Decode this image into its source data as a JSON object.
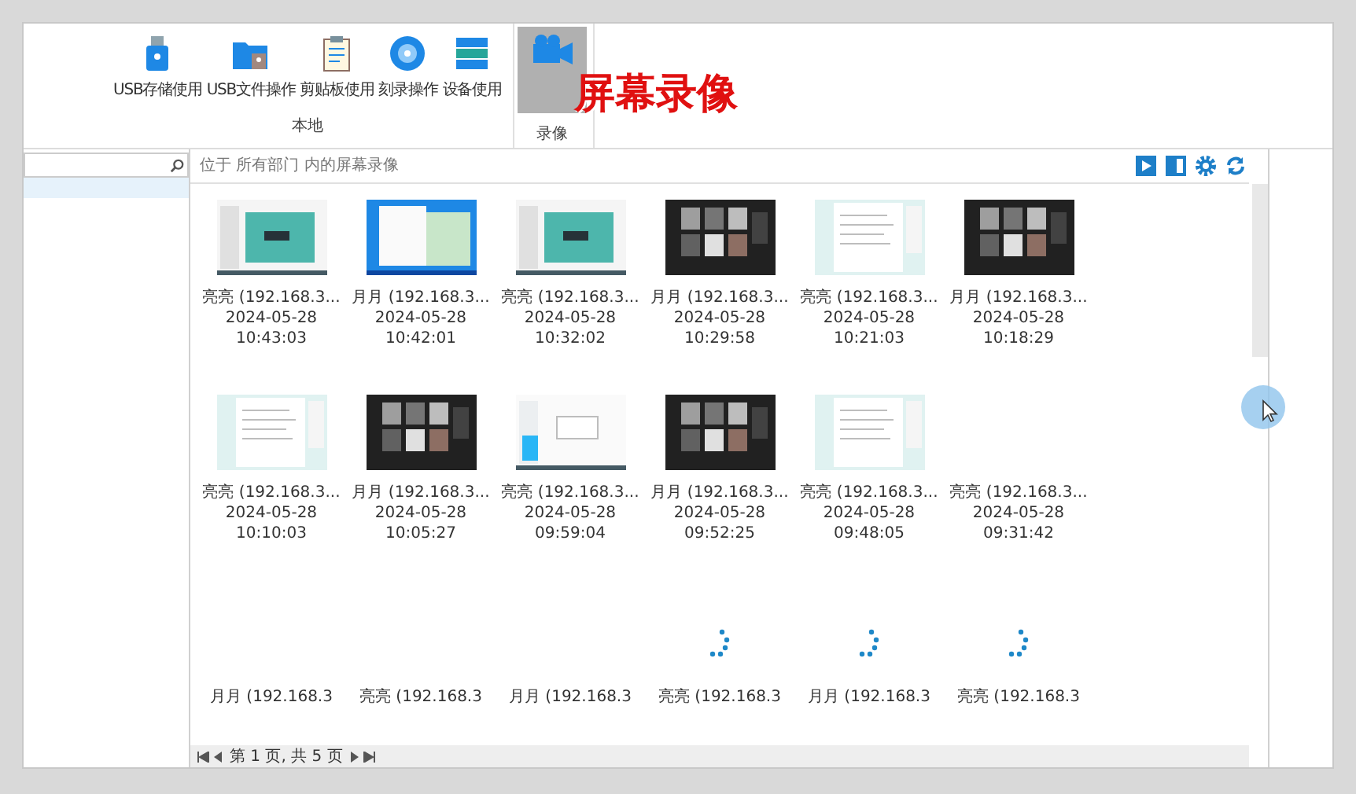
{
  "ribbon": {
    "items": [
      {
        "label": "USB存储使用"
      },
      {
        "label": "USB文件操作"
      },
      {
        "label": "剪贴板使用"
      },
      {
        "label": "刻录操作"
      },
      {
        "label": "设备使用"
      }
    ],
    "group_label": "本地",
    "selected_group": {
      "label": "录像",
      "selected": true
    }
  },
  "caption": "屏幕录像",
  "content": {
    "breadcrumb": "位于 所有部门 内的屏幕录像",
    "recordings": [
      {
        "name": "亮亮 (192.168.3...",
        "date": "2024-05-28",
        "time": "10:43:03"
      },
      {
        "name": "月月 (192.168.3...",
        "date": "2024-05-28",
        "time": "10:42:01"
      },
      {
        "name": "亮亮 (192.168.3...",
        "date": "2024-05-28",
        "time": "10:32:02"
      },
      {
        "name": "月月 (192.168.3...",
        "date": "2024-05-28",
        "time": "10:29:58"
      },
      {
        "name": "亮亮 (192.168.3...",
        "date": "2024-05-28",
        "time": "10:21:03"
      },
      {
        "name": "月月 (192.168.3...",
        "date": "2024-05-28",
        "time": "10:18:29"
      },
      {
        "name": "亮亮 (192.168.3...",
        "date": "2024-05-28",
        "time": "10:10:03"
      },
      {
        "name": "月月 (192.168.3...",
        "date": "2024-05-28",
        "time": "10:05:27"
      },
      {
        "name": "亮亮 (192.168.3...",
        "date": "2024-05-28",
        "time": "09:59:04"
      },
      {
        "name": "月月 (192.168.3...",
        "date": "2024-05-28",
        "time": "09:52:25"
      },
      {
        "name": "亮亮 (192.168.3...",
        "date": "2024-05-28",
        "time": "09:48:05"
      },
      {
        "name": "亮亮 (192.168.3...",
        "date": "2024-05-28",
        "time": "09:31:42"
      },
      {
        "name": "月月 (192.168.3"
      },
      {
        "name": "亮亮 (192.168.3"
      },
      {
        "name": "月月 (192.168.3"
      },
      {
        "name": "亮亮 (192.168.3",
        "loading": true
      },
      {
        "name": "月月 (192.168.3",
        "loading": true
      },
      {
        "name": "亮亮 (192.168.3",
        "loading": true
      }
    ],
    "pager": "第 1 页, 共 5 页"
  }
}
